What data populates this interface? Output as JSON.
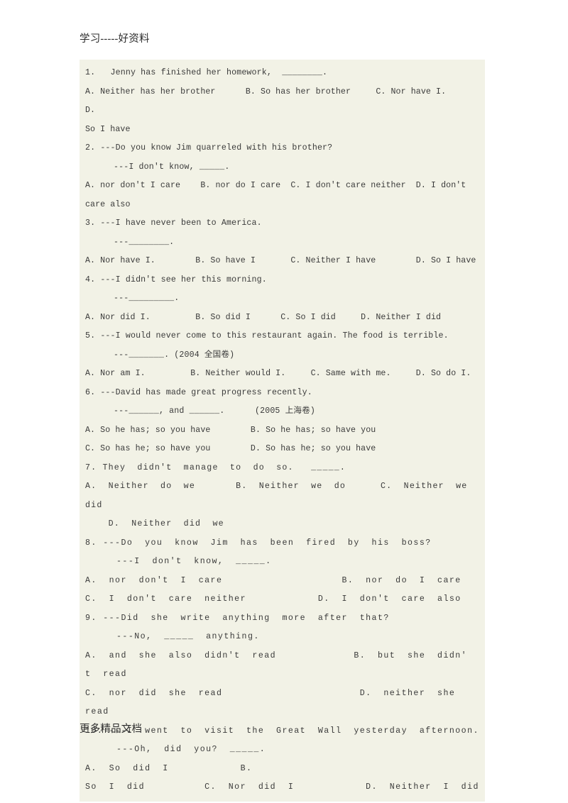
{
  "document": {
    "header_watermark": "学习-----好资料",
    "footer_watermark": "更多精品文档",
    "background_color": "#ffffff",
    "content_block_color": "#f2f2e6",
    "text_color": "#3a3a3a"
  },
  "questions": [
    {
      "number": "1.",
      "stem": "1.   Jenny has finished her homework,  ________.",
      "reply": "",
      "options_lines": [
        "A. Neither has her brother      B. So has her brother     C. Nor have I.        D.",
        "So I have"
      ]
    },
    {
      "number": "2.",
      "stem": "2. ---Do you know Jim quarreled with his brother?",
      "reply": "---I don't know, _____.",
      "options_lines": [
        "A. nor don't I care    B. nor do I care  C. I don't care neither  D. I don't",
        "care also"
      ]
    },
    {
      "number": "3.",
      "stem": "3. ---I have never been to America.",
      "reply": "---________.",
      "options_lines": [
        "A. Nor have I.        B. So have I       C. Neither I have        D. So I have"
      ]
    },
    {
      "number": "4.",
      "stem": "4. ---I didn't see her this morning.",
      "reply": "---_________.",
      "options_lines": [
        "A. Nor did I.         B. So did I      C. So I did     D. Neither I did"
      ]
    },
    {
      "number": "5.",
      "stem": "5. ---I would never come to this restaurant again. The food is terrible.",
      "reply": "---_______. (2004 全国卷)",
      "options_lines": [
        "A. Nor am I.         B. Neither would I.     C. Same with me.     D. So do I."
      ]
    },
    {
      "number": "6.",
      "stem": "6. ---David has made great progress recently.",
      "reply": "---______, and ______.      (2005 上海卷)",
      "options_lines": [
        "A. So he has; so you have        B. So he has; so have you",
        "C. So has he; so have you        D. So has he; so you have"
      ]
    },
    {
      "number": "7.",
      "stem": "7. They  didn't  manage  to  do  so.   _____.",
      "reply": "",
      "options_lines": [
        "A.  Neither  do  we       B.  Neither  we  do      C.  Neither  we  did",
        "    D.  Neither  did  we"
      ]
    },
    {
      "number": "8.",
      "stem": "8. ---Do  you  know  Jim  has  been  fired  by  his  boss?",
      "reply": "---I  don't  know,  _____.",
      "options_lines": [
        "A.  nor  don't  I  care                    B.  nor  do  I  care",
        "C.  I  don't  care  neither            D.  I  don't  care  also"
      ]
    },
    {
      "number": "9.",
      "stem": "9. ---Did  she  write  anything  more  after  that?",
      "reply": "---No,  _____  anything.",
      "options_lines": [
        "A.  and  she  also  didn't  read             B.  but  she  didn'",
        "t  read",
        "C.  nor  did  she  read                       D.  neither  she  read"
      ]
    },
    {
      "number": "10.",
      "stem": "10. ---I  went  to  visit  the  Great  Wall  yesterday  afternoon.",
      "reply": "---Oh,  did  you?  _____.",
      "options_lines": [
        "A.  So  did  I            B.",
        "So  I  did          C.  Nor  did  I            D.  Neither  I  did"
      ]
    }
  ]
}
